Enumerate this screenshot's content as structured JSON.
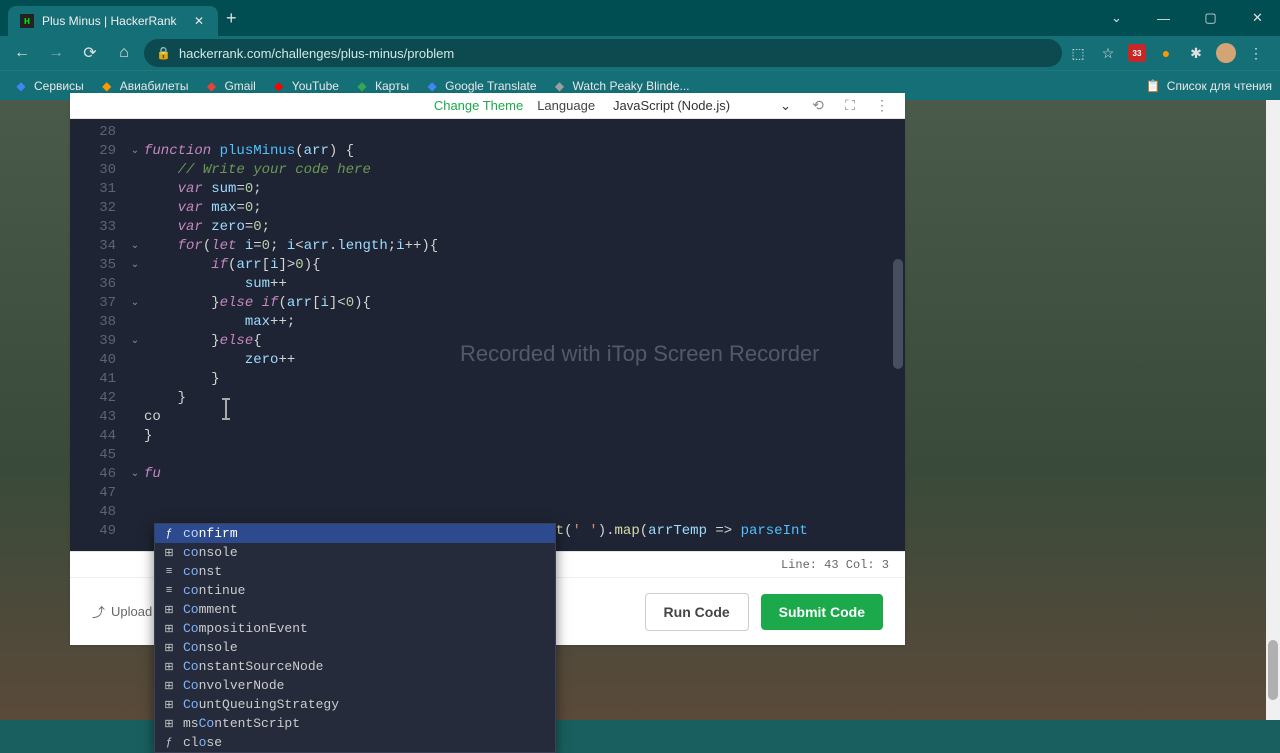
{
  "browser": {
    "tab_title": "Plus Minus | HackerRank",
    "url": "hackerrank.com/challenges/plus-minus/problem",
    "win_min": "—",
    "win_max": "▢",
    "win_close": "✕",
    "win_down": "⌄",
    "bookmarks": [
      {
        "icon_color": "#4285f4",
        "label": "Сервисы"
      },
      {
        "icon_color": "#ff9800",
        "label": "Авиабилеты"
      },
      {
        "icon_color": "#ea4335",
        "label": "Gmail"
      },
      {
        "icon_color": "#ff0000",
        "label": "YouTube"
      },
      {
        "icon_color": "#34a853",
        "label": "Карты"
      },
      {
        "icon_color": "#4285f4",
        "label": "Google Translate"
      },
      {
        "icon_color": "#9e9e9e",
        "label": "Watch Peaky Blinde..."
      }
    ],
    "read_list": "Список для чтения",
    "ext_badge": "33"
  },
  "editor_header": {
    "change_theme": "Change Theme",
    "language_label": "Language",
    "language_value": "JavaScript (Node.js)"
  },
  "watermark": "Recorded with iTop Screen Recorder",
  "code": {
    "lines": [
      {
        "n": 28,
        "fold": "",
        "html": ""
      },
      {
        "n": 29,
        "fold": "⌄",
        "html": "<span class='kw'>function</span> <span class='fn'>plusMinus</span>(<span class='param'>arr</span>) {"
      },
      {
        "n": 30,
        "fold": "",
        "html": "    <span class='cm'>// Write your code here</span>"
      },
      {
        "n": 31,
        "fold": "",
        "html": "    <span class='kw'>var</span> <span class='var'>sum</span>=<span class='num'>0</span>;"
      },
      {
        "n": 32,
        "fold": "",
        "html": "    <span class='kw'>var</span> <span class='var'>max</span>=<span class='num'>0</span>;"
      },
      {
        "n": 33,
        "fold": "",
        "html": "    <span class='kw'>var</span> <span class='var'>zero</span>=<span class='num'>0</span>;"
      },
      {
        "n": 34,
        "fold": "⌄",
        "html": "    <span class='kw'>for</span>(<span class='kw'>let</span> <span class='var'>i</span>=<span class='num'>0</span>; <span class='var'>i</span>&lt;<span class='var'>arr</span>.<span class='prop'>length</span>;<span class='var'>i</span>++){"
      },
      {
        "n": 35,
        "fold": "⌄",
        "html": "        <span class='kw'>if</span>(<span class='var'>arr</span>[<span class='var'>i</span>]&gt;<span class='num'>0</span>){"
      },
      {
        "n": 36,
        "fold": "",
        "html": "            <span class='var'>sum</span>++"
      },
      {
        "n": 37,
        "fold": "⌄",
        "html": "        }<span class='kw'>else</span> <span class='kw'>if</span>(<span class='var'>arr</span>[<span class='var'>i</span>]&lt;<span class='num'>0</span>){"
      },
      {
        "n": 38,
        "fold": "",
        "html": "            <span class='var'>max</span>++;"
      },
      {
        "n": 39,
        "fold": "⌄",
        "html": "        }<span class='kw'>else</span>{"
      },
      {
        "n": 40,
        "fold": "",
        "html": "            <span class='var'>zero</span>++"
      },
      {
        "n": 41,
        "fold": "",
        "html": "        }"
      },
      {
        "n": 42,
        "fold": "",
        "html": "    }"
      },
      {
        "n": 43,
        "fold": "",
        "html": "co"
      },
      {
        "n": 44,
        "fold": "",
        "html": "}"
      },
      {
        "n": 45,
        "fold": "",
        "html": ""
      },
      {
        "n": 46,
        "fold": "⌄",
        "html": "<span class='kw'>fu</span>"
      },
      {
        "n": 47,
        "fold": "",
        "html": ""
      },
      {
        "n": 48,
        "fold": "",
        "html": ""
      },
      {
        "n": 49,
        "fold": "",
        "html": "  (a                                           <span class='mth'>lit</span>(<span class='str'>' '</span>).<span class='mth'>map</span>(<span class='param'>arrTemp</span> =&gt; <span class='fn'>parseInt</span>"
      }
    ]
  },
  "autocomplete": {
    "items": [
      {
        "icon": "ƒ",
        "bold": "co",
        "rest": "nfirm",
        "selected": true
      },
      {
        "icon": "⊞",
        "bold": "co",
        "rest": "nsole",
        "selected": false
      },
      {
        "icon": "≡",
        "bold": "co",
        "rest": "nst",
        "selected": false
      },
      {
        "icon": "≡",
        "bold": "co",
        "rest": "ntinue",
        "selected": false
      },
      {
        "icon": "⊞",
        "bold": "Co",
        "rest": "mment",
        "selected": false
      },
      {
        "icon": "⊞",
        "bold": "Co",
        "rest": "mpositionEvent",
        "selected": false
      },
      {
        "icon": "⊞",
        "bold": "Co",
        "rest": "nsole",
        "selected": false
      },
      {
        "icon": "⊞",
        "bold": "Co",
        "rest": "nstantSourceNode",
        "selected": false
      },
      {
        "icon": "⊞",
        "bold": "Co",
        "rest": "nvolverNode",
        "selected": false
      },
      {
        "icon": "⊞",
        "bold": "Co",
        "rest": "untQueuingStrategy",
        "selected": false
      },
      {
        "icon": "⊞",
        "bold": "",
        "rest": "ms",
        "bold2": "Co",
        "rest2": "ntentScript",
        "selected": false
      },
      {
        "icon": "ƒ",
        "bold": "",
        "rest": "cl",
        "bold2": "o",
        "rest2": "se",
        "selected": false
      }
    ]
  },
  "status": {
    "text": "Line: 43 Col: 3"
  },
  "footer": {
    "upload": "Upload",
    "run": "Run Code",
    "submit": "Submit Code"
  }
}
